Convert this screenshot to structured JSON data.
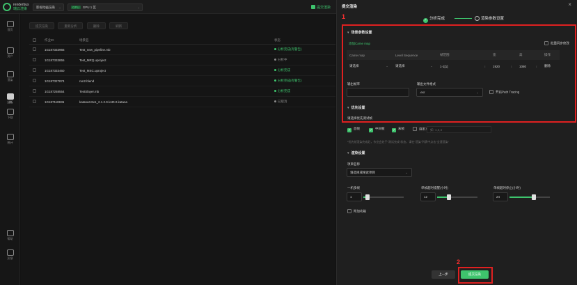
{
  "topbar": {
    "logo_line1": "renderbus",
    "logo_line2": "瑞云渲染",
    "project_select": "影视动画渲染",
    "gpu_badge": "GPU",
    "gpu_select": "GPU 1 区",
    "render_btn": "提交渲染"
  },
  "sidebar": {
    "items": [
      {
        "label": "首页"
      },
      {
        "label": "资产"
      },
      {
        "label": "渲染"
      },
      {
        "label": "分析"
      },
      {
        "label": "下载"
      },
      {
        "label": "统计"
      },
      {
        "label": "帮助"
      },
      {
        "label": "反馈"
      }
    ]
  },
  "toolbar": {
    "btns": [
      "提交渲染",
      "重新分析",
      "删除",
      "刷新"
    ]
  },
  "table": {
    "headers": {
      "id": "作业ID",
      "name": "场景名",
      "status": "状态"
    },
    "rows": [
      {
        "id": "1G187333966",
        "name": "Test_new_pipeline.mb",
        "status": "分析完成(有警告)",
        "grey": false
      },
      {
        "id": "1G187333855",
        "name": "Test_MRQ.uproject",
        "status": "分析中",
        "grey": true
      },
      {
        "id": "1G187333460",
        "name": "Test_MSC.uproject",
        "status": "分析完成",
        "grey": false
      },
      {
        "id": "1G187327874",
        "name": "run2.blend",
        "status": "分析完成(有警告)",
        "grey": false
      },
      {
        "id": "1G187258554",
        "name": "TestSlayer.mb",
        "status": "分析完成",
        "grey": false
      },
      {
        "id": "1G187118936",
        "name": "katana3.8v1_2.1.2.9-kst0.0.katana",
        "status": "已取消",
        "grey": true
      }
    ]
  },
  "dialog": {
    "title": "提交渲染",
    "close": "×",
    "step1": "分析完成",
    "step1_mark": "✓",
    "step2": "渲染参数设置",
    "anno1": "1",
    "anno2": "2",
    "scene_section": "场景参数设置",
    "add_camera": "添加Came map",
    "batch_modify": "批量同步修改",
    "cm_headers": {
      "camera": "Came map",
      "level": "Level Sequence",
      "frames": "帧范围",
      "width": "宽",
      "height": "高",
      "action": "操作"
    },
    "cm_row": {
      "camera": "请选择",
      "level": "请选择",
      "frames": "1-1[1]",
      "width": "1920",
      "height": "1080",
      "action": "删除"
    },
    "output_rate_label": "输出帧率",
    "output_rate_value": "",
    "output_format_label": "输出文件格式",
    "output_format_value": ".exr",
    "path_tracing": "开启Path Tracing",
    "priority_section": "优先设置",
    "priority_hint": "请选择优先测试帧",
    "first_frame": "首帧",
    "middle_frame": "中间帧",
    "last_frame": "末帧",
    "custom_frame": "自定义帧",
    "custom_frame_placeholder": "如: 1,2,4",
    "priority_note": "*优先帧渲染完成后，作业会处于\"测试完成\"状态，请在\"渲染\"列表中点击\"全速渲染\"",
    "render_section": "渲染设置",
    "project_name_label": "项目名称",
    "project_name_value": "请选择或搜索项目",
    "multi_frame_label": "一机多帧",
    "multi_frame_value": "1",
    "timeout_warn_label": "单帧超时提醒(小时)",
    "timeout_warn_value": "12",
    "timeout_stop_label": "单帧超时停止(小时)",
    "timeout_stop_value": "24",
    "extra_func": "附加功能",
    "prev_btn": "上一步",
    "submit_btn": "提交渲染",
    "slider1_level": 0.1,
    "slider2_level": 0.3,
    "slider3_level": 0.6
  }
}
